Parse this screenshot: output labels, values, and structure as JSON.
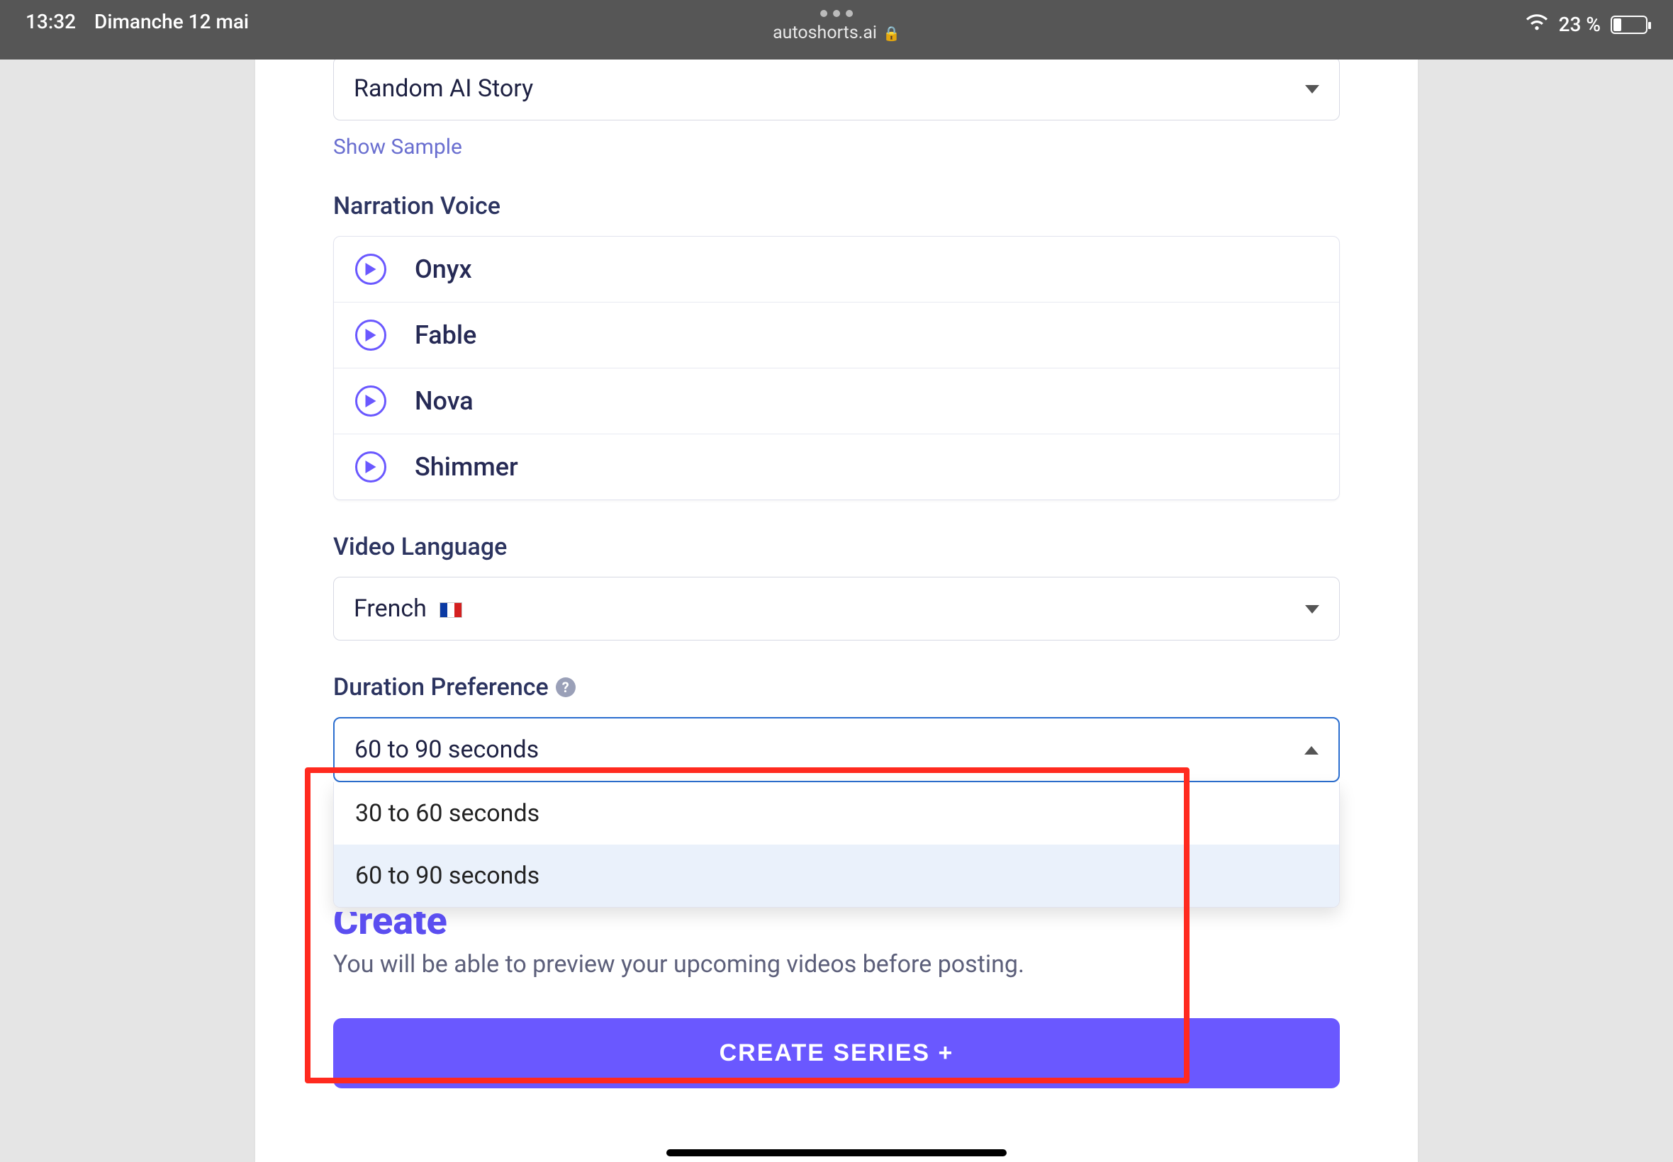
{
  "status": {
    "time": "13:32",
    "date": "Dimanche 12 mai",
    "url": "autoshorts.ai",
    "battery_pct": "23 %"
  },
  "story_select": {
    "value": "Random AI Story"
  },
  "show_sample": "Show Sample",
  "narration_label": "Narration Voice",
  "voices": [
    {
      "name": "Onyx"
    },
    {
      "name": "Fable"
    },
    {
      "name": "Nova"
    },
    {
      "name": "Shimmer"
    }
  ],
  "video_language_label": "Video Language",
  "video_language_value": "French",
  "duration_label": "Duration Preference",
  "duration_value": "60 to 90 seconds",
  "duration_options": [
    "30 to 60 seconds",
    "60 to 90 seconds"
  ],
  "create_word": "Create",
  "note": "You will be able to preview your upcoming videos before posting.",
  "cta": "CREATE SERIES +"
}
